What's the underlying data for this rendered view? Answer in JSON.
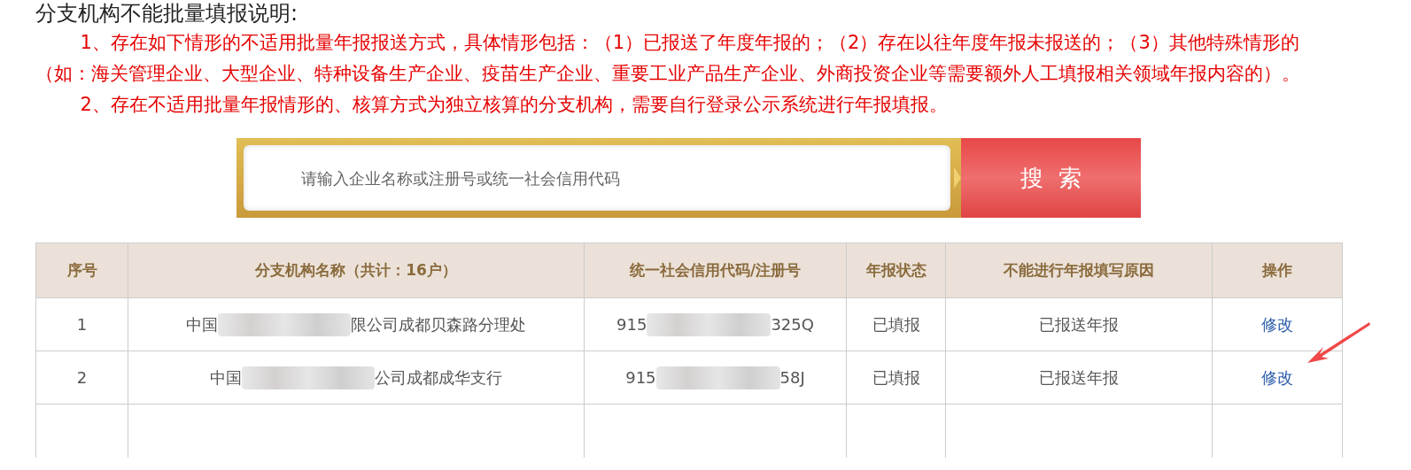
{
  "heading": "分支机构不能批量填报说明:",
  "notes": [
    "1、存在如下情形的不适用批量年报报送方式，具体情形包括：（1）已报送了年度年报的；（2）存在以往年度年报未报送的；（3）其他特殊情形的（如：海关管理企业、大型企业、特种设备生产企业、疫苗生产企业、重要工业产品生产企业、外商投资企业等需要额外人工填报相关领域年报内容的）。",
    "2、存在不适用批量年报情形的、核算方式为独立核算的分支机构，需要自行登录公示系统进行年报填报。"
  ],
  "search": {
    "placeholder": "请输入企业名称或注册号或统一社会信用代码",
    "button": "搜  索"
  },
  "table": {
    "columns": [
      "序号",
      "分支机构名称（共计：16户）",
      "统一社会信用代码/注册号",
      "年报状态",
      "不能进行年报填写原因",
      "操作"
    ],
    "rows": [
      {
        "index": "1",
        "name_start": "中国",
        "name_end": "限公司成都贝森路分理处",
        "code_start": "915",
        "code_end": "325Q",
        "status": "已填报",
        "reason": "已报送年报",
        "action": "修改"
      },
      {
        "index": "2",
        "name_start": "中国",
        "name_end": "公司成都成华支行",
        "code_start": "915",
        "code_end": "58J",
        "status": "已填报",
        "reason": "已报送年报",
        "action": "修改"
      }
    ]
  }
}
